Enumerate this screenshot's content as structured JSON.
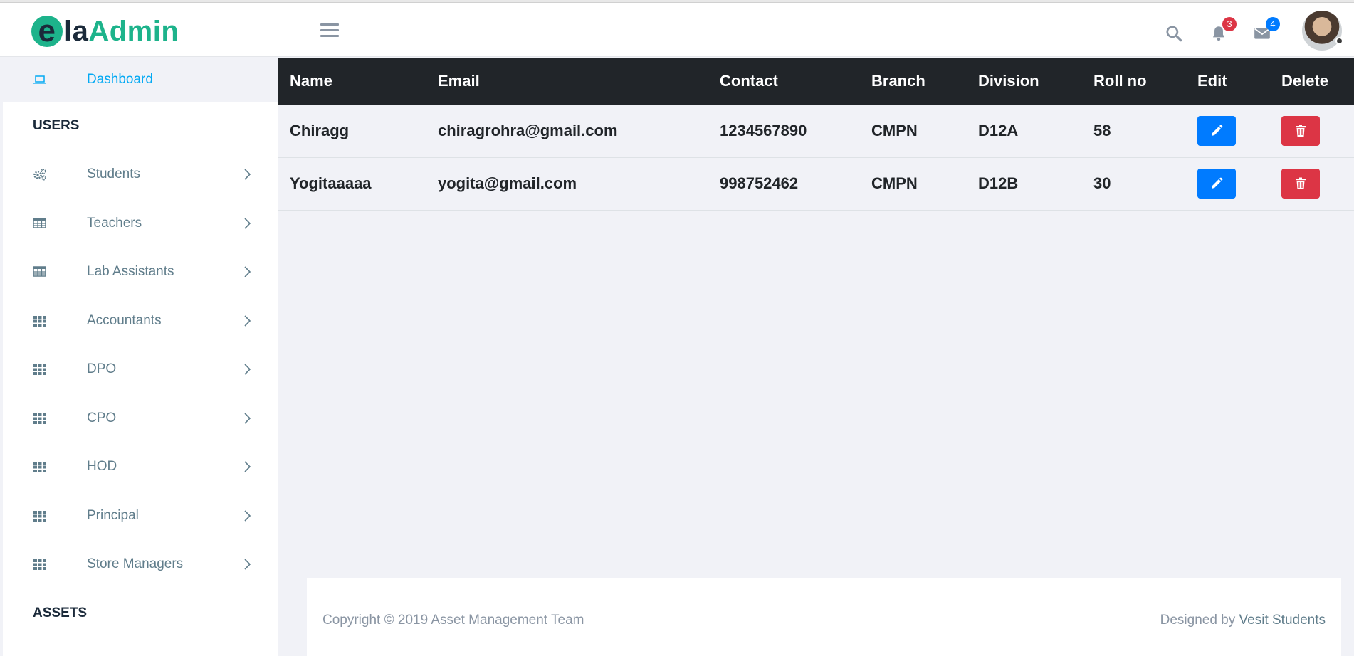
{
  "brand": {
    "logo_e": "e",
    "logo_la": "la",
    "logo_admin": "Admin"
  },
  "header": {
    "notifications_count": "3",
    "messages_count": "4"
  },
  "sidebar": {
    "dashboard_label": "Dashboard",
    "users_heading": "USERS",
    "items": [
      {
        "label": "Students",
        "icon": "cogs-icon"
      },
      {
        "label": "Teachers",
        "icon": "table-icon"
      },
      {
        "label": "Lab Assistants",
        "icon": "table-icon"
      },
      {
        "label": "Accountants",
        "icon": "grid-icon"
      },
      {
        "label": "DPO",
        "icon": "grid-icon"
      },
      {
        "label": "CPO",
        "icon": "grid-icon"
      },
      {
        "label": "HOD",
        "icon": "grid-icon"
      },
      {
        "label": "Principal",
        "icon": "grid-icon"
      },
      {
        "label": "Store Managers",
        "icon": "grid-icon"
      }
    ],
    "assets_heading": "ASSETS"
  },
  "table": {
    "headers": [
      "Name",
      "Email",
      "Contact",
      "Branch",
      "Division",
      "Roll no",
      "Edit",
      "Delete"
    ],
    "rows": [
      {
        "name": "Chiragg",
        "email": "chiragrohra@gmail.com",
        "contact": "1234567890",
        "branch": "CMPN",
        "division": "D12A",
        "roll": "58"
      },
      {
        "name": "Yogitaaaaa",
        "email": "yogita@gmail.com",
        "contact": "998752462",
        "branch": "CMPN",
        "division": "D12B",
        "roll": "30"
      }
    ]
  },
  "footer": {
    "copyright": "Copyright © 2019 Asset Management Team",
    "designed_by": "Designed by",
    "designer": "Vesit Students"
  },
  "colors": {
    "accent": "#03a9f3",
    "brand": "#1db38b",
    "edit": "#007bff",
    "delete": "#dc3545",
    "thead": "#212529"
  }
}
